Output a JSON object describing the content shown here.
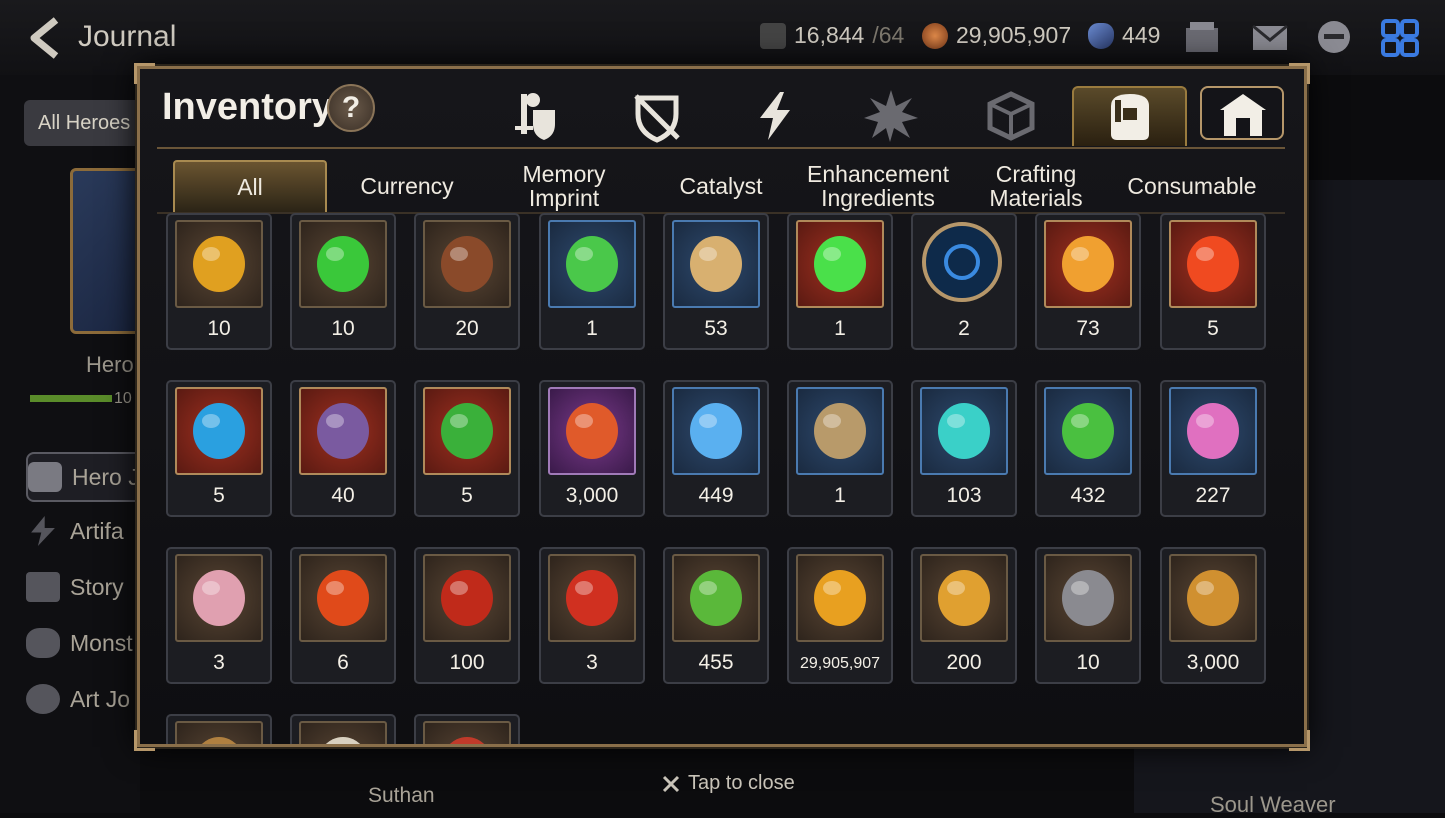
{
  "header": {
    "title": "Journal",
    "stamina": "16,844",
    "stamina_cap": "/64",
    "gold": "29,905,907",
    "skystones": "449"
  },
  "background": {
    "all_heroes_label": "All Heroes",
    "hero_label": "Hero",
    "hero_progress_num": "10",
    "menu": [
      "Hero J",
      "Artifa",
      "Story",
      "Monst",
      "Art Jo"
    ],
    "bottom_hero_name": "Suthan",
    "right_label": "Soul Weaver"
  },
  "dialog": {
    "title": "Inventory",
    "help_label": "?",
    "category_icons": [
      "equipment-icon",
      "shield-slash-icon",
      "lightning-icon",
      "burst-icon",
      "cube-icon",
      "bag-icon",
      "storehouse-icon"
    ],
    "subtabs": [
      {
        "label": "All",
        "active": true
      },
      {
        "label": "Currency"
      },
      {
        "label": "Memory\nImprint"
      },
      {
        "label": "Catalyst"
      },
      {
        "label": "Enhancement\nIngredients"
      },
      {
        "label": "Crafting\nMaterials"
      },
      {
        "label": "Consumable"
      }
    ]
  },
  "items": [
    {
      "count": "10",
      "icon": "amber-gem-icon",
      "frame": "brown",
      "color": "#e0a020"
    },
    {
      "count": "10",
      "icon": "green-gem-icon",
      "frame": "brown",
      "color": "#3ac83a"
    },
    {
      "count": "20",
      "icon": "claw-icon",
      "frame": "brown",
      "color": "#8a4a2a"
    },
    {
      "count": "1",
      "icon": "slime-balls-icon",
      "frame": "blue",
      "color": "#4ac84a"
    },
    {
      "count": "53",
      "icon": "feather-branch-icon",
      "frame": "blue",
      "color": "#d8b070"
    },
    {
      "count": "1",
      "icon": "green-orb-icon",
      "frame": "red",
      "color": "#4ae04a"
    },
    {
      "count": "2",
      "icon": "blue-rune-disc-icon",
      "frame": "round",
      "color": "#3a8ae0"
    },
    {
      "count": "73",
      "icon": "orange-crystal-icon",
      "frame": "red",
      "color": "#f0a030"
    },
    {
      "count": "5",
      "icon": "fire-amulet-icon",
      "frame": "red",
      "color": "#f04a20"
    },
    {
      "count": "5",
      "icon": "blue-amulet-icon",
      "frame": "red",
      "color": "#2aa0e0"
    },
    {
      "count": "40",
      "icon": "purple-amulet-icon",
      "frame": "red",
      "color": "#7a5aa0"
    },
    {
      "count": "5",
      "icon": "clover-amulet-icon",
      "frame": "red",
      "color": "#3ab03a"
    },
    {
      "count": "3,000",
      "icon": "flower-ring-icon",
      "frame": "purple",
      "color": "#e05a2a"
    },
    {
      "count": "449",
      "icon": "skystone-icon",
      "frame": "blue",
      "color": "#5ab0f0"
    },
    {
      "count": "1",
      "icon": "key-icon",
      "frame": "blue",
      "color": "#b89a6a"
    },
    {
      "count": "103",
      "icon": "teal-crystal-icon",
      "frame": "blue",
      "color": "#3ad0c8"
    },
    {
      "count": "432",
      "icon": "leaf-icon",
      "frame": "blue",
      "color": "#4ac040"
    },
    {
      "count": "227",
      "icon": "pink-crystals-icon",
      "frame": "blue",
      "color": "#e070c0"
    },
    {
      "count": "3",
      "icon": "robot-capsule-icon",
      "frame": "brown",
      "color": "#e0a0b0"
    },
    {
      "count": "6",
      "icon": "magma-orb-icon",
      "frame": "brown",
      "color": "#e04a1a"
    },
    {
      "count": "100",
      "icon": "red-band-icon",
      "frame": "brown",
      "color": "#c02a1a"
    },
    {
      "count": "3",
      "icon": "red-seal-icon",
      "frame": "brown",
      "color": "#d03020"
    },
    {
      "count": "455",
      "icon": "green-heart-icon",
      "frame": "brown",
      "color": "#5ab83a"
    },
    {
      "count": "29,905,907",
      "icon": "gold-coin-icon",
      "frame": "brown",
      "color": "#e8a020",
      "small": true
    },
    {
      "count": "200",
      "icon": "gold-badge-icon",
      "frame": "brown",
      "color": "#e0a030"
    },
    {
      "count": "10",
      "icon": "stone-box-icon",
      "frame": "brown",
      "color": "#8a8a90"
    },
    {
      "count": "3,000",
      "icon": "fist-emblem-icon",
      "frame": "brown",
      "color": "#d09030"
    },
    {
      "count": "",
      "icon": "partial-item-icon",
      "frame": "brown",
      "color": "#b08040"
    },
    {
      "count": "",
      "icon": "partial-item-icon",
      "frame": "brown",
      "color": "#d8d0c0"
    },
    {
      "count": "",
      "icon": "partial-item-icon",
      "frame": "brown",
      "color": "#c03a2a"
    }
  ],
  "footer": {
    "close_label": "Tap to close"
  }
}
